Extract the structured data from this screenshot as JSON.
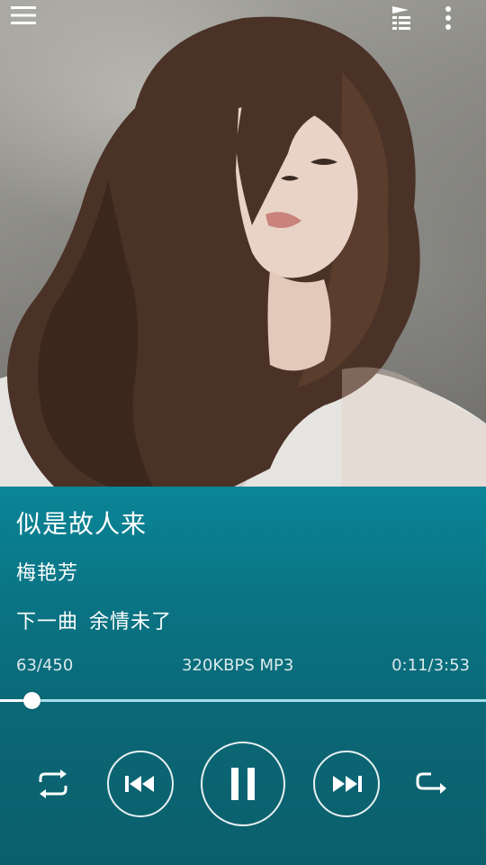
{
  "top_bar": {
    "menu_icon": "hamburger-menu-icon",
    "queue_icon": "playlist-queue-icon",
    "more_icon": "more-vertical-icon"
  },
  "now_playing": {
    "title": "似是故人来",
    "artist": "梅艳芳",
    "next_label": "下一曲",
    "next_title": "余情未了",
    "track_position": "63/450",
    "bitrate": "320KBPS MP3",
    "time": "0:11/3:53",
    "progress_fraction": 0.047
  },
  "controls": {
    "repeat_icon": "repeat-icon",
    "prev_icon": "skip-previous-icon",
    "play_pause_icon": "pause-icon",
    "next_icon": "skip-next-icon",
    "order_icon": "play-order-icon"
  },
  "colors": {
    "panel_top": "#0a8597",
    "panel_bottom": "#0b5f6c",
    "progress_track": "#b4ebf5",
    "foreground": "#ffffff"
  }
}
